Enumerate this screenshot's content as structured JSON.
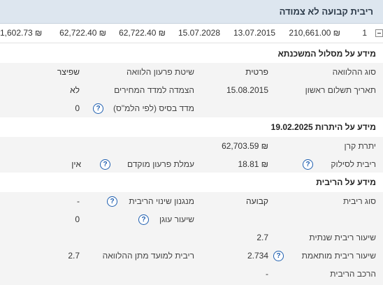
{
  "header": {
    "title": "ריבית קבועה לא צמודה"
  },
  "loan_row": {
    "index": "1",
    "principal": "210,661.00 ₪",
    "start_date": "13.07.2015",
    "end_date": "15.07.2028",
    "balance1": "62,722.40 ₪",
    "balance2": "62,722.40 ₪",
    "payment": "1,602.73 ₪"
  },
  "track_info": {
    "title": "מידע על מסלול המשכנתא",
    "loan_type_label": "סוג ההלוואה",
    "loan_type_value": "פרטית",
    "repayment_method_label": "שיטת פרעון הלוואה",
    "repayment_method_value": "שפיצר",
    "first_payment_label": "תאריך תשלום ראשון",
    "first_payment_value": "15.08.2015",
    "indexation_label": "הצמדה למדד המחירים",
    "indexation_value": "לא",
    "base_index_label": "מדד בסיס (לפי הלמ\"ס)",
    "base_index_value": "0"
  },
  "balance_info": {
    "title": "מידע על היתרות 19.02.2025",
    "principal_balance_label": "יתרת קרן",
    "principal_balance_value": "62,703.59 ₪",
    "payoff_interest_label": "ריבית לסילוק",
    "payoff_interest_value": "18.81 ₪",
    "early_fee_label": "עמלת פרעון מוקדם",
    "early_fee_value": "אין"
  },
  "interest_info": {
    "title": "מידע על הריבית",
    "interest_type_label": "סוג ריבית",
    "interest_type_value": "קבועה",
    "change_mechanism_label": "מנגנון שינוי הריבית",
    "change_mechanism_value": "-",
    "anchor_rate_label": "שיעור עוגן",
    "anchor_rate_value": "0",
    "annual_rate_label": "שיעור ריבית שנתית",
    "annual_rate_value": "2.7",
    "adjusted_rate_label": "שיעור ריבית מותאמת",
    "adjusted_rate_value": "2.734",
    "rate_at_loan_label": "ריבית למועד מתן ההלוואה",
    "rate_at_loan_value": "2.7",
    "composition_label": "הרכב הריבית",
    "composition_value": "-"
  },
  "icons": {
    "help": "?"
  }
}
